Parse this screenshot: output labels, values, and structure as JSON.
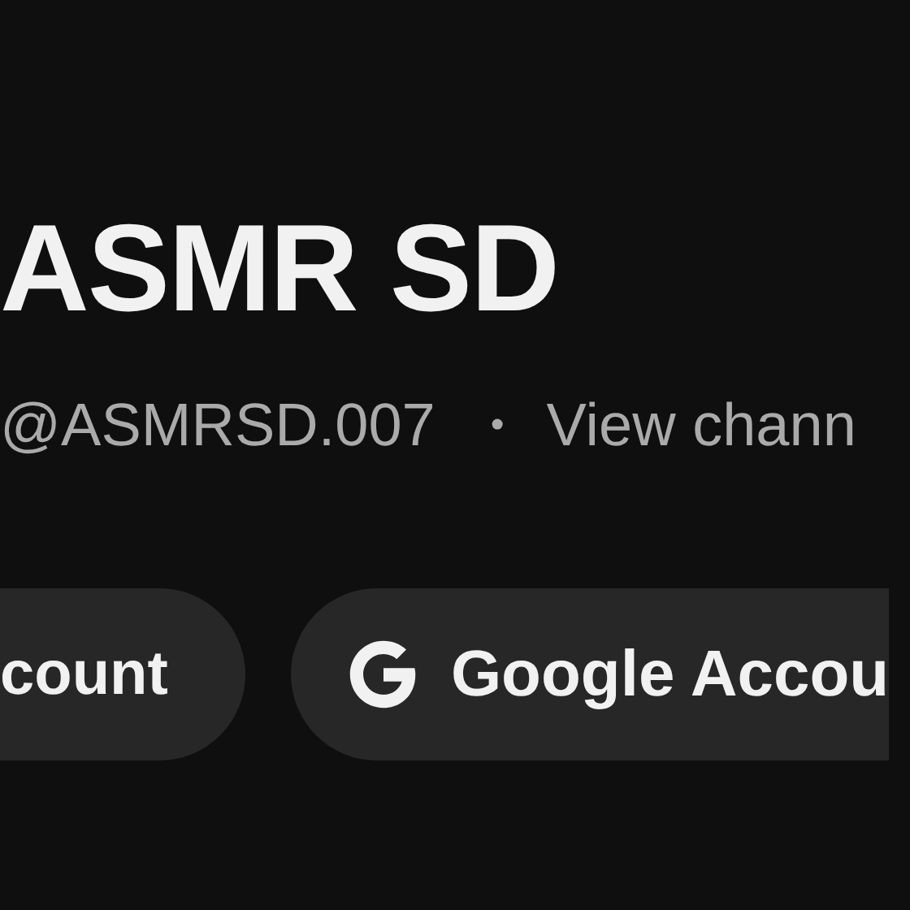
{
  "channel": {
    "name": "ASMR SD",
    "handle": "@ASMRSD.007",
    "separator": "•",
    "link": "View chann"
  },
  "buttons": [
    {
      "label": "count",
      "kind": "plain"
    },
    {
      "label": "Google Accou",
      "kind": "iconed"
    }
  ]
}
